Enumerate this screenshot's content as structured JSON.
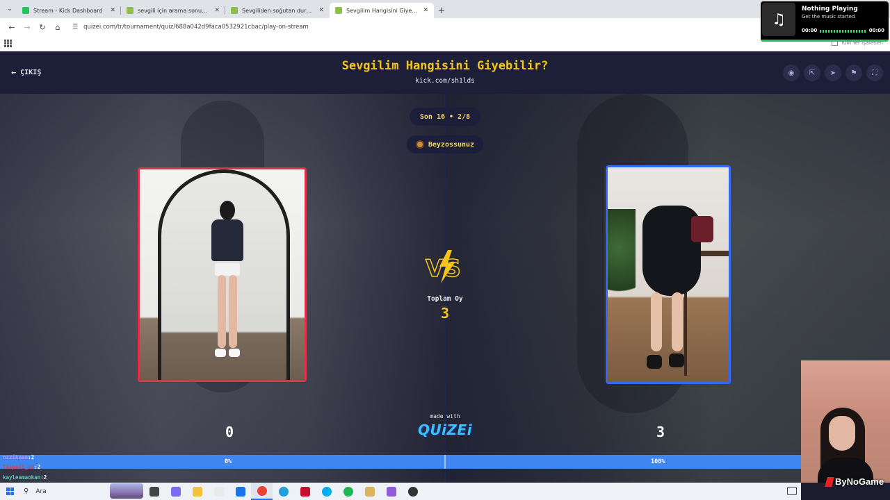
{
  "browser": {
    "tabs": [
      {
        "label": "Stream - Kick Dashboard",
        "favicon_color": "#22c55e",
        "active": false
      },
      {
        "label": "sevgili için arama sonuçları - Quizei",
        "favicon_color": "#8fbf4a",
        "active": false
      },
      {
        "label": "Sevgiliden soğutan durumlar",
        "favicon_color": "#8fbf4a",
        "active": false
      },
      {
        "label": "Sevgilim Hangisini Giyebilir? - Quizei",
        "favicon_color": "#8fbf4a",
        "active": true
      }
    ],
    "url": "quizei.com/tr/tournament/quiz/688a042d9faca0532921cbac/play-on-stream",
    "all_bookmarks": "Tüm Yer İşaretleri"
  },
  "now_playing": {
    "title": "Nothing Playing",
    "subtitle": "Get the music started",
    "time_start": "00:00",
    "time_end": "00:00"
  },
  "quiz": {
    "back_label": "ÇIKIŞ",
    "title": "Sevgilim Hangisini Giyebilir?",
    "subtitle": "kick.com/sh1lds",
    "round": "Son 16 • 2/8",
    "user": "Beyzossunuz",
    "total_votes_label": "Toplam Oy",
    "total_votes": "3",
    "left_score": "0",
    "right_score": "3",
    "left_percent": "0%",
    "right_percent": "100%",
    "right_percent_fraction": 1.0,
    "made_with": "made with",
    "brand": "QUiZEi",
    "header_icons": [
      "eye-icon",
      "share-icon",
      "send-icon",
      "flag-icon",
      "fullscreen-icon"
    ]
  },
  "chat": [
    {
      "name": "ozzikaan",
      "count": "2",
      "color": "#b794f4"
    },
    {
      "name": "Taipeit_vr",
      "count": "2",
      "color": "#e53e3e"
    },
    {
      "name": "kayleamaokan",
      "count": "2",
      "color": "#4fd1c5"
    }
  ],
  "overlay": {
    "brand": "ByNoGame"
  },
  "taskbar": {
    "search_placeholder": "Ara",
    "apps": [
      {
        "name": "task-view-icon",
        "color": "#444444"
      },
      {
        "name": "copilot-icon",
        "color": "#7c6cf0"
      },
      {
        "name": "file-explorer-icon",
        "color": "#f2c23a"
      },
      {
        "name": "store-icon",
        "color": "#e9e9e9"
      },
      {
        "name": "outlook-icon",
        "color": "#1a73e8"
      },
      {
        "name": "chrome-icon",
        "color": "#e94235"
      },
      {
        "name": "edge-icon",
        "color": "#1fa0d8"
      },
      {
        "name": "app-icon",
        "color": "#c8102e"
      },
      {
        "name": "skype-icon",
        "color": "#00aff0"
      },
      {
        "name": "spotify-icon",
        "color": "#1db954"
      },
      {
        "name": "app-icon-2",
        "color": "#d8b45a"
      },
      {
        "name": "discord-icon",
        "color": "#8f5bd8"
      },
      {
        "name": "obs-icon",
        "color": "#333333"
      }
    ]
  }
}
